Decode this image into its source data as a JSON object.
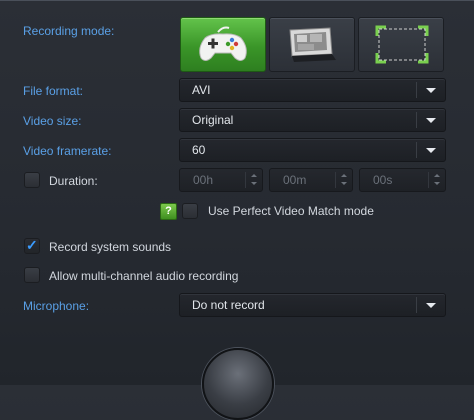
{
  "recording_mode": {
    "label": "Recording mode:",
    "options": [
      {
        "name": "Game",
        "icon": "gamepad-icon",
        "active": true
      },
      {
        "name": "Desktop",
        "icon": "monitor-icon",
        "active": false
      },
      {
        "name": "Area",
        "icon": "selection-area-icon",
        "active": false
      }
    ]
  },
  "file_format": {
    "label": "File format:",
    "value": "AVI"
  },
  "video_size": {
    "label": "Video size:",
    "value": "Original"
  },
  "video_framerate": {
    "label": "Video framerate:",
    "value": "60"
  },
  "duration": {
    "label": "Duration:",
    "checked": false,
    "hours": "00h",
    "minutes": "00m",
    "seconds": "00s"
  },
  "perfect_match": {
    "help": "?",
    "label": "Use Perfect Video Match mode",
    "checked": false
  },
  "system_sounds": {
    "label": "Record system sounds",
    "checked": true
  },
  "multichannel": {
    "label": "Allow multi-channel audio recording",
    "checked": false
  },
  "microphone": {
    "label": "Microphone:",
    "value": "Do not record"
  },
  "colors": {
    "accent_label": "#5aa0e6",
    "active_mode": "#3a9528",
    "check": "#3b9cff"
  }
}
